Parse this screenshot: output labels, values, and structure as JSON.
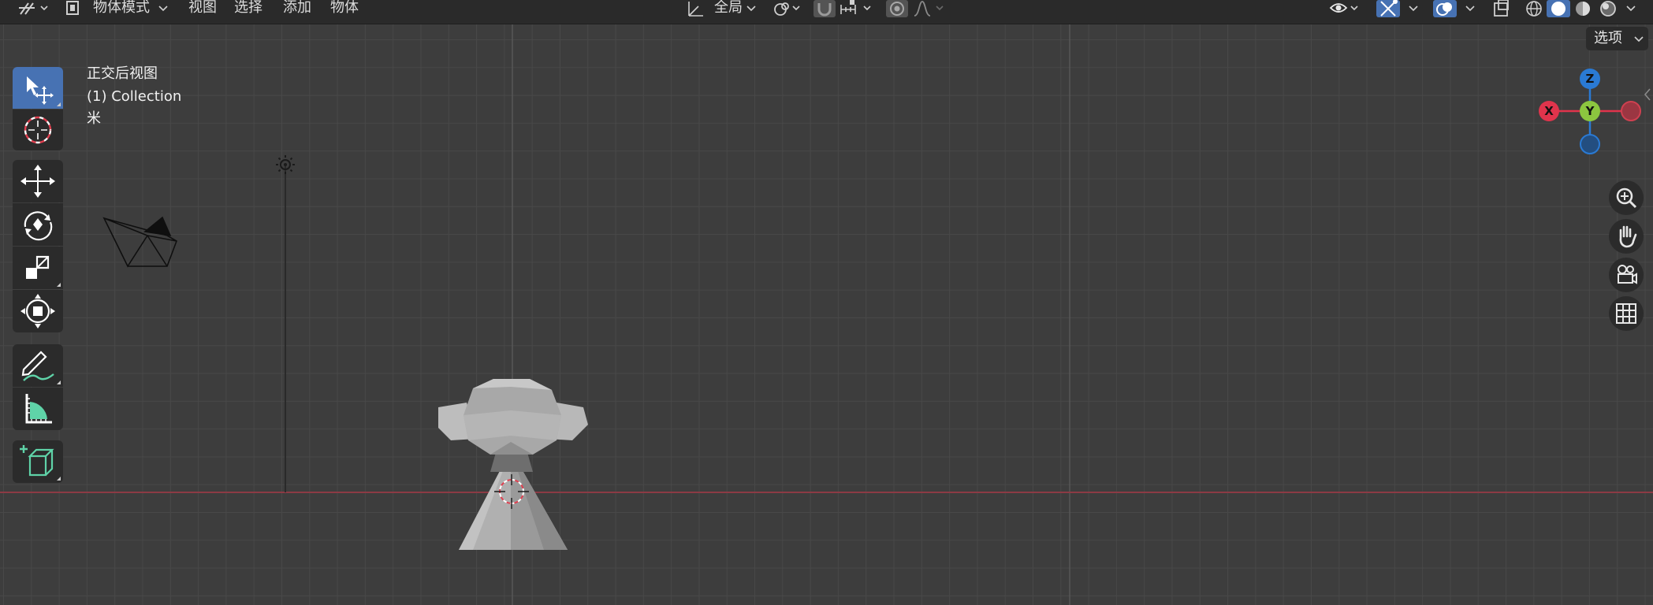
{
  "header": {
    "mode_label": "物体模式",
    "menu": [
      "视图",
      "选择",
      "添加",
      "物体"
    ],
    "orientation_label": "全局"
  },
  "viewport": {
    "view_name": "正交后视图",
    "collection_label": "(1) Collection",
    "unit_label": "米",
    "options_label": "选项"
  },
  "gizmo": {
    "z": "Z",
    "y": "Y",
    "x": "X"
  },
  "colors": {
    "accent": "#4772b3",
    "x_axis": "#e0344c",
    "y_axis": "#8cc63f",
    "z_axis": "#2a7ad4"
  },
  "toolbar": {
    "tools": [
      "select-box-icon",
      "cursor-icon",
      "move-icon",
      "rotate-icon",
      "scale-icon",
      "transform-icon",
      "annotate-icon",
      "measure-icon",
      "add-cube-icon"
    ]
  },
  "nav": [
    "zoom-icon",
    "pan-hand-icon",
    "camera-view-icon",
    "ortho-grid-icon"
  ]
}
